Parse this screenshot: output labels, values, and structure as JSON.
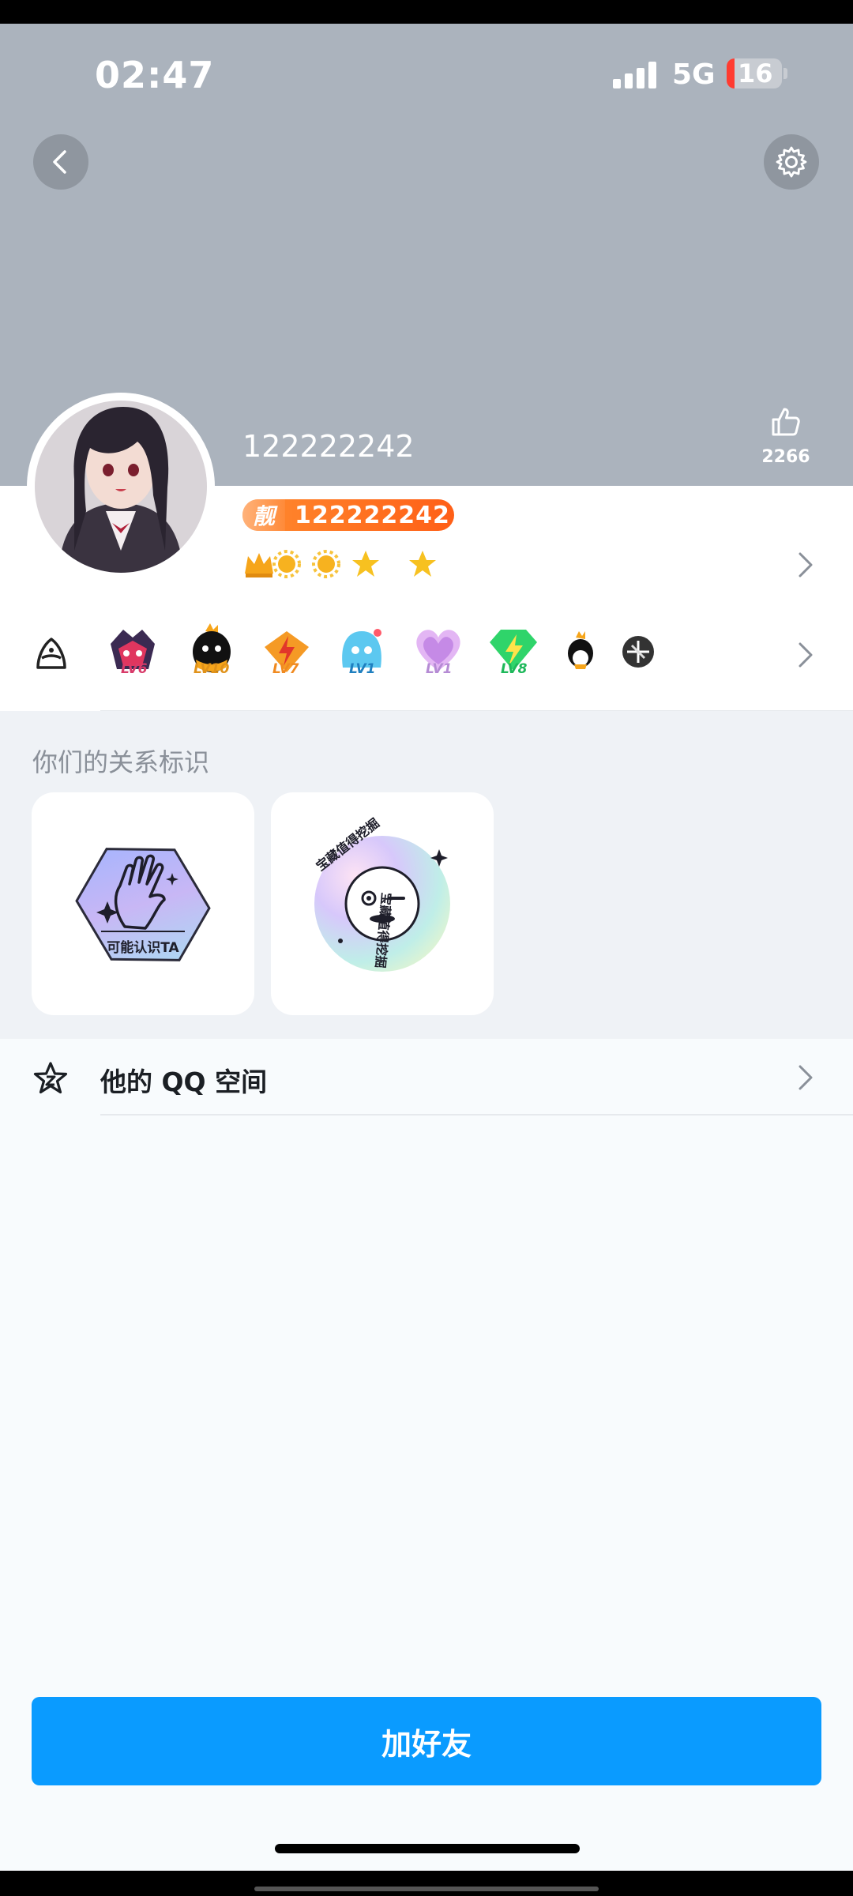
{
  "status_bar": {
    "time": "02:47",
    "network": "5G",
    "battery": "16"
  },
  "header": {
    "likes": "2266",
    "nickname": "122222242"
  },
  "vip": {
    "tag": "靓",
    "qq_number": "122222242"
  },
  "level_icons": [
    "crown-icon",
    "sun-icon",
    "sun-icon",
    "star-icon",
    "star-icon"
  ],
  "badges": [
    {
      "icon": "lv6-badge",
      "label": "LV6"
    },
    {
      "icon": "lv10-badge",
      "label": "LV10"
    },
    {
      "icon": "lv7-badge",
      "label": "LV7"
    },
    {
      "icon": "lv1-badge",
      "label": "LV1"
    },
    {
      "icon": "lv1-heart-badge",
      "label": "LV1"
    },
    {
      "icon": "lv8-badge",
      "label": "LV8"
    },
    {
      "icon": "penguin-badge",
      "label": ""
    },
    {
      "icon": "cf-badge",
      "label": ""
    }
  ],
  "relationship": {
    "title": "你们的关系标识",
    "cards": [
      {
        "label": "可能认识TA"
      },
      {
        "label": "宝藏值得挖掘"
      }
    ]
  },
  "qzone": {
    "label": "他的 QQ 空间"
  },
  "action": {
    "add_friend": "加好友"
  },
  "colors": {
    "header": "#abb3bd",
    "primary": "#0a9bff",
    "vip": "#ff6a1f"
  }
}
